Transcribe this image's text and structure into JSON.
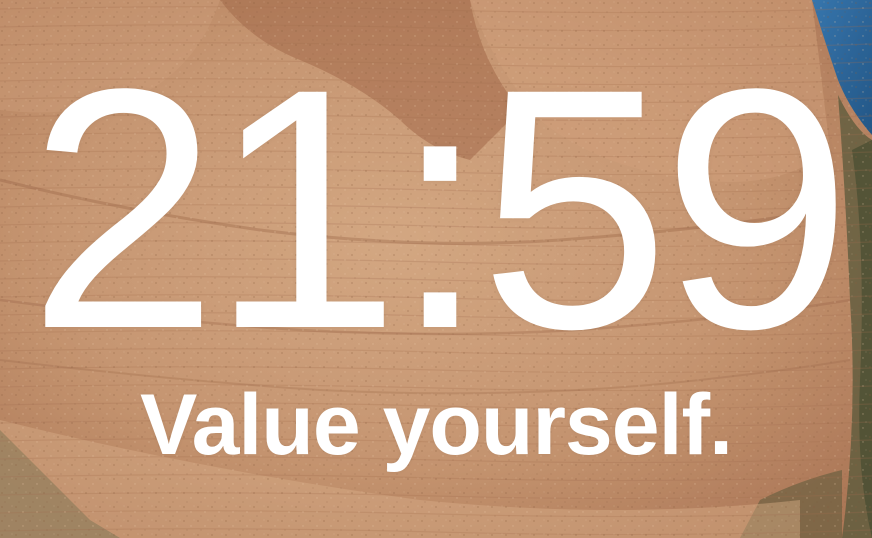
{
  "lock_screen": {
    "time": "21:59",
    "message": "Value yourself."
  },
  "wallpaper": {
    "icon": "sandstone-canyon-aerial-photo",
    "colors": {
      "rock": "#c9936e",
      "rock_light": "#e0b48f",
      "rock_dark": "#9d6a4a",
      "water": "#2f6fa8",
      "vegetation": "#4f5a3a"
    }
  }
}
